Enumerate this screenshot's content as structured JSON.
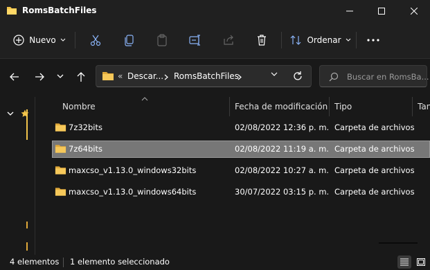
{
  "window": {
    "title": "RomsBatchFiles"
  },
  "toolbar": {
    "new_label": "Nuevo",
    "sort_label": "Ordenar"
  },
  "address": {
    "prefix": "«",
    "segments": [
      "Descar...",
      "RomsBatchFiles"
    ]
  },
  "search": {
    "placeholder": "Buscar en RomsBa..."
  },
  "columns": {
    "name": "Nombre",
    "modified": "Fecha de modificación",
    "type": "Tipo",
    "size": "Tan"
  },
  "files": [
    {
      "name": "7z32bits",
      "modified": "02/08/2022 12:36 p. m.",
      "type": "Carpeta de archivos",
      "selected": false
    },
    {
      "name": "7z64bits",
      "modified": "02/08/2022 11:19 a. m.",
      "type": "Carpeta de archivos",
      "selected": true
    },
    {
      "name": "maxcso_v1.13.0_windows32bits",
      "modified": "02/08/2022 10:27 a. m.",
      "type": "Carpeta de archivos",
      "selected": false
    },
    {
      "name": "maxcso_v1.13.0_windows64bits",
      "modified": "30/07/2022 03:15 p. m.",
      "type": "Carpeta de archivos",
      "selected": false
    }
  ],
  "status": {
    "count": "4 elementos",
    "selection": "1 elemento seleccionado"
  },
  "colors": {
    "folder": "#f2c44b",
    "accent": "#60cdff",
    "selected_row": "#777777"
  }
}
